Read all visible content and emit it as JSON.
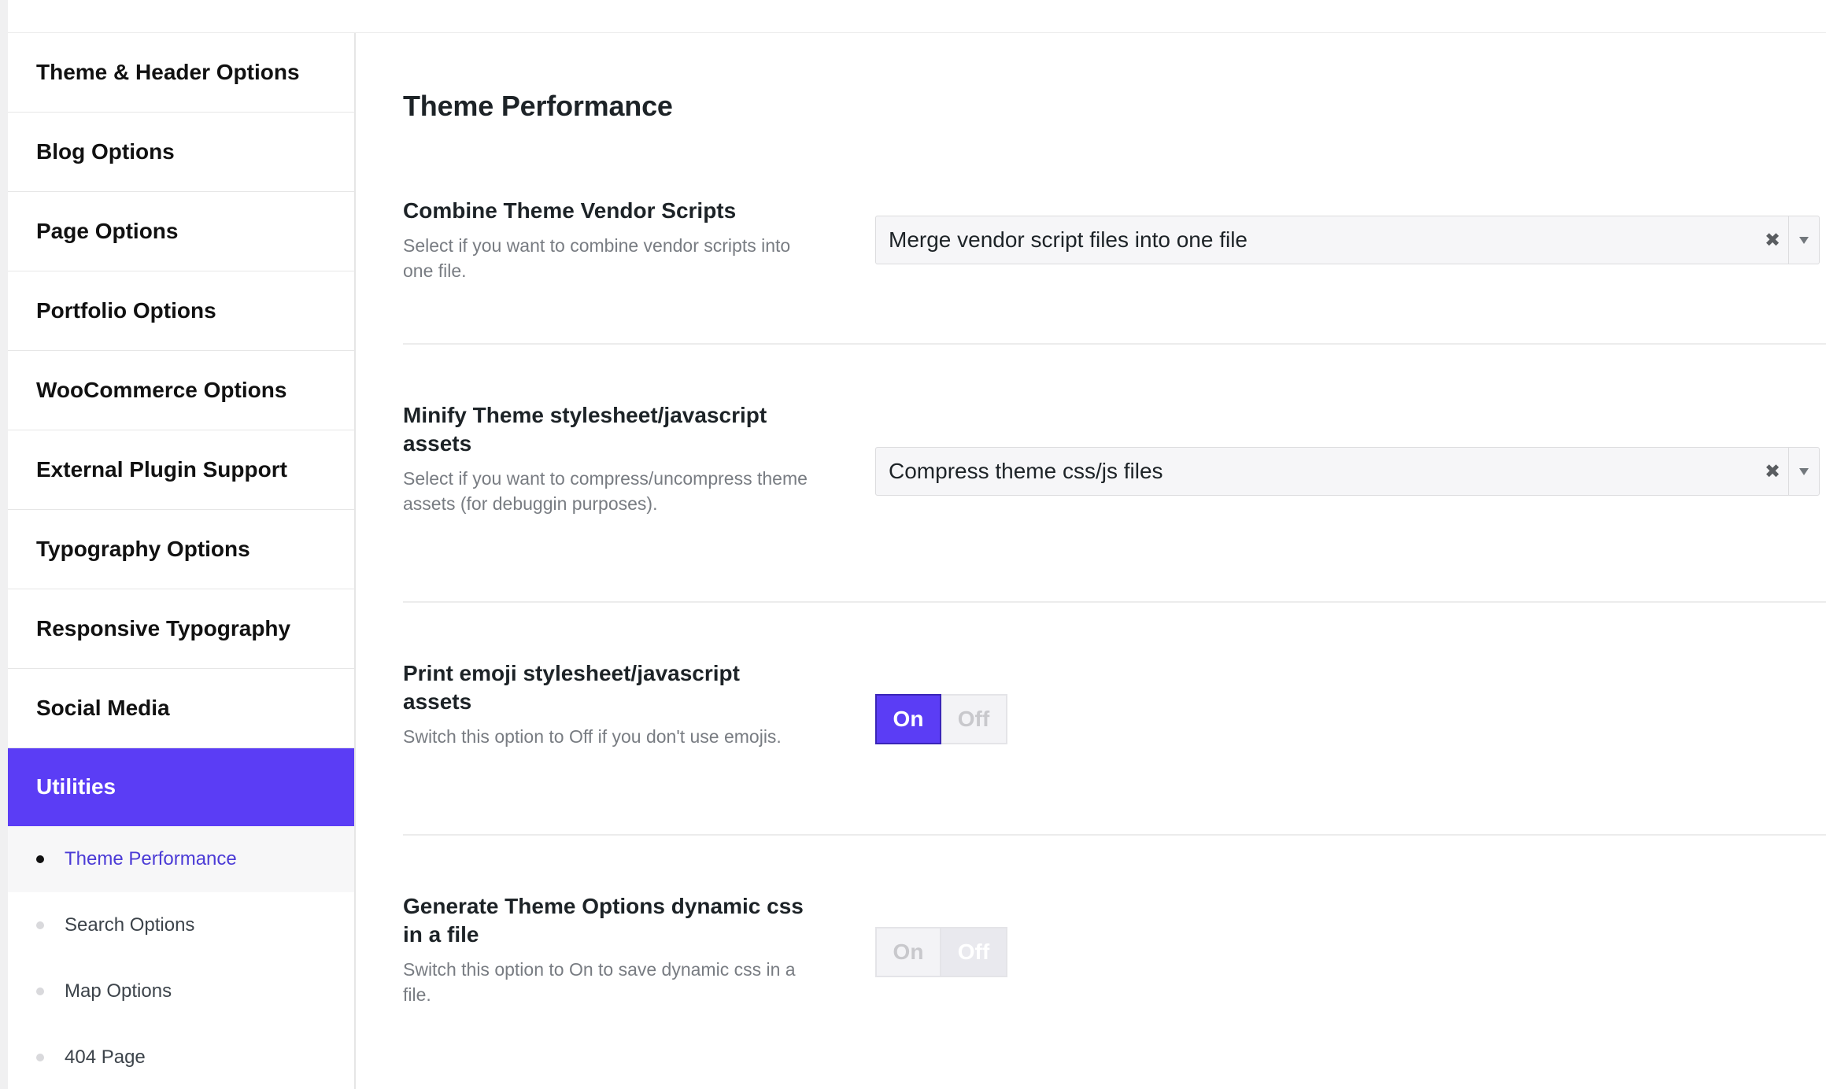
{
  "sidebar": {
    "items": [
      {
        "label": "Theme & Header Options"
      },
      {
        "label": "Blog Options"
      },
      {
        "label": "Page Options"
      },
      {
        "label": "Portfolio Options"
      },
      {
        "label": "WooCommerce Options"
      },
      {
        "label": "External Plugin Support"
      },
      {
        "label": "Typography Options"
      },
      {
        "label": "Responsive Typography"
      },
      {
        "label": "Social Media"
      },
      {
        "label": "Utilities"
      }
    ],
    "active_item": "Utilities",
    "sub_items": [
      {
        "label": "Theme Performance"
      },
      {
        "label": "Search Options"
      },
      {
        "label": "Map Options"
      },
      {
        "label": "404 Page"
      }
    ],
    "active_sub_item": "Theme Performance"
  },
  "main": {
    "title": "Theme Performance",
    "options": [
      {
        "title": "Combine Theme Vendor Scripts",
        "description": "Select if you want to combine vendor scripts into one file.",
        "control": "select",
        "value": "Merge vendor script files into one file"
      },
      {
        "title": "Minify Theme stylesheet/javascript assets",
        "description": "Select if you want to compress/uncompress theme assets (for debuggin purposes).",
        "control": "select",
        "value": "Compress theme css/js files"
      },
      {
        "title": "Print emoji stylesheet/javascript assets",
        "description": "Switch this option to Off if you don't use emojis.",
        "control": "toggle",
        "on_label": "On",
        "off_label": "Off",
        "state": "On"
      },
      {
        "title": "Generate Theme Options dynamic css in a file",
        "description": "Switch this option to On to save dynamic css in a file.",
        "control": "toggle",
        "on_label": "On",
        "off_label": "Off",
        "state": "Off"
      }
    ]
  },
  "colors": {
    "accent": "#5b3df5",
    "sub_active_text": "#4b3bd6"
  },
  "icons": {
    "clear": "close-icon",
    "dropdown": "chevron-down-icon"
  }
}
